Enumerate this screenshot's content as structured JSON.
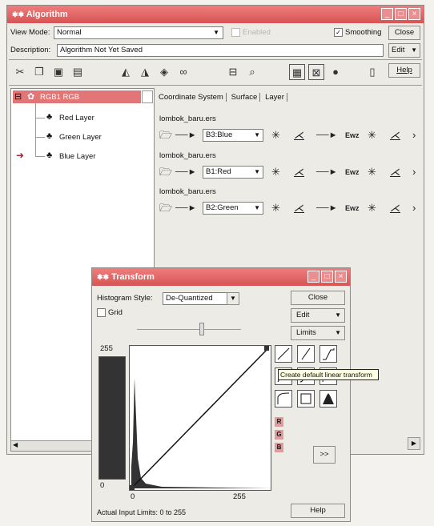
{
  "colors": {
    "titlebar": "#d75454",
    "selected_row": "#e27676",
    "tooltip_bg": "#ffffe1"
  },
  "algorithm_window": {
    "title": "Algorithm",
    "title_icon": "app-icon",
    "view_mode_label": "View Mode:",
    "view_mode_value": "Normal",
    "faded_check_label": "Enabled",
    "smoothing_label": "Smoothing",
    "smoothing_checked": true,
    "close_label": "Close",
    "edit_label": "Edit",
    "help_label": "Help",
    "description_label": "Description:",
    "description_value": "Algorithm Not Yet Saved",
    "toolbar_icons": [
      "scissors-icon",
      "copy-icon",
      "paste-icon",
      "clipboard-icon",
      "layer-add-icon",
      "layer-remove-icon",
      "layer-edit-icon",
      "link-icon",
      "stack-icon",
      "zoom-icon",
      "grid-icon",
      "box-icon",
      "stop-icon",
      "page-icon"
    ],
    "tree": {
      "root_label": "RGB1 RGB",
      "layers": [
        "Red Layer",
        "Green Layer",
        "Blue Layer"
      ]
    },
    "tabs": [
      "Coordinate System",
      "Surface",
      "Layer"
    ],
    "chains": [
      {
        "dataset": "lombok_baru.ers",
        "band": "B3:Blue"
      },
      {
        "dataset": "lombok_baru.ers",
        "band": "B1:Red"
      },
      {
        "dataset": "lombok_baru.ers",
        "band": "B2:Green"
      }
    ]
  },
  "transform_window": {
    "title": "Transform",
    "histogram_style_label": "Histogram Style:",
    "histogram_style_value": "De-Quantized",
    "grid_label": "Grid",
    "close_label": "Close",
    "edit_label": "Edit",
    "limits_label": "Limits",
    "help_label": "Help",
    "output_max": "255",
    "output_min": "0",
    "input_min": "0",
    "input_max": "255",
    "rgb_labels": [
      "R",
      "G",
      "B"
    ],
    "more_label": ">>",
    "tooltip": "Create default linear transform",
    "footer": "Actual Input Limits: 0 to 255"
  }
}
